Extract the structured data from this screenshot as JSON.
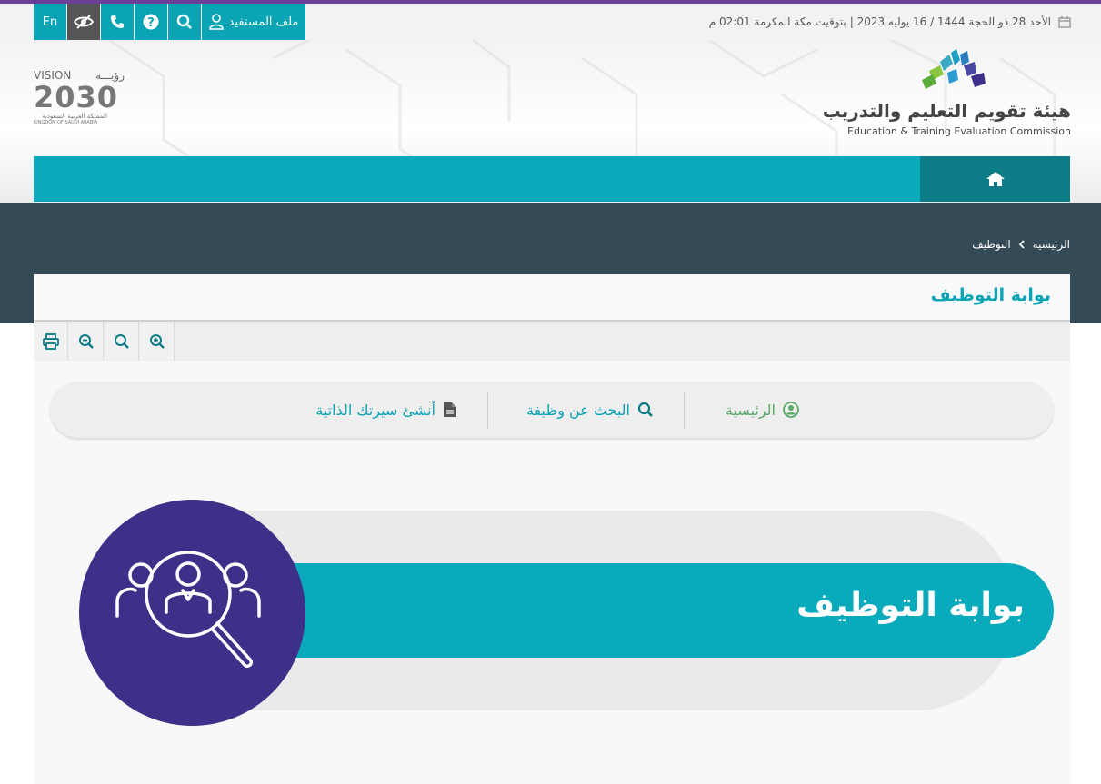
{
  "topbar": {
    "datetime": "الأحد 28 ذو الحجة 1444 / 16 يوليه 2023 | بتوقيت مكة المكرمة 02:01 م",
    "icons": [
      "calendar-icon"
    ]
  },
  "utility": {
    "profile_label": "ملف المستفيد",
    "lang_label": "En",
    "icons": [
      "user-icon",
      "search-icon",
      "help-icon",
      "phone-icon",
      "eye-slash-icon"
    ]
  },
  "vision": {
    "top_en": "VISION",
    "top_ar": "رؤيـــة",
    "year": "2030",
    "sub_ar": "المملكة العربية السعودية",
    "sub_en": "KINGDOM OF SAUDI ARABIA"
  },
  "logo": {
    "name_ar": "هيئة تقويم التعليم والتدريب",
    "name_en": "Education & Training Evaluation Commission"
  },
  "nav": {
    "icons": [
      "home-icon"
    ]
  },
  "breadcrumb": {
    "home": "الرئيسية",
    "current": "التوظيف"
  },
  "page": {
    "title": "بوابة التوظيف"
  },
  "tools": {
    "icons": [
      "zoom-in-icon",
      "zoom-reset-icon",
      "zoom-out-icon",
      "print-icon"
    ]
  },
  "portal_nav": {
    "items": [
      {
        "label": "الرئيسية",
        "icon": "user-circle-icon"
      },
      {
        "label": "البحث عن وظيفة",
        "icon": "search-icon"
      },
      {
        "label": "أنشئ سيرتك الذاتية",
        "icon": "document-icon"
      }
    ]
  },
  "hero": {
    "title": "بوابة التوظيف",
    "icon": "people-search-icon"
  },
  "colors": {
    "teal": "#0aa9bc",
    "teal_dark": "#0d7c87",
    "purple": "#3e3088",
    "slate": "#354a57",
    "green_link": "#5aaa6a"
  }
}
